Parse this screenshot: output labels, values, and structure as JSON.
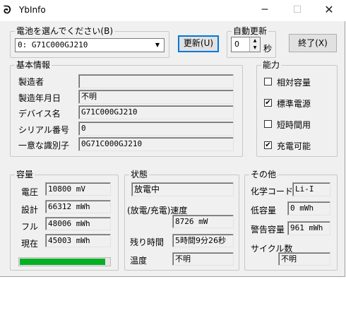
{
  "window": {
    "title": "YbInfo",
    "minimize_glyph": "─",
    "maximize_glyph": "☐",
    "close_glyph": "✕"
  },
  "battery_select": {
    "label": "電池を選んでください(B)",
    "selected": "0: G71C000GJ210",
    "arrow": "▼"
  },
  "refresh_button": {
    "label": "更新(U)"
  },
  "auto_refresh": {
    "label": "自動更新",
    "value": "0",
    "unit": "秒",
    "up": "▲",
    "down": "▼"
  },
  "exit_button": {
    "label": "終了(X)"
  },
  "basic_info": {
    "title": "基本情報",
    "rows": [
      {
        "label": "製造者",
        "value": ""
      },
      {
        "label": "製造年月日",
        "value": "不明"
      },
      {
        "label": "デバイス名",
        "value": "G71C000GJ210"
      },
      {
        "label": "シリアル番号",
        "value": "0"
      },
      {
        "label": "一意な識別子",
        "value": "0G71C000GJ210"
      }
    ]
  },
  "capability": {
    "title": "能力",
    "items": [
      {
        "label": "相対容量",
        "checked": false,
        "mark": ""
      },
      {
        "label": "標準電源",
        "checked": true,
        "mark": "✔"
      },
      {
        "label": "短時間用",
        "checked": false,
        "mark": ""
      },
      {
        "label": "充電可能",
        "checked": true,
        "mark": "✔"
      }
    ]
  },
  "capacity": {
    "title": "容量",
    "rows": [
      {
        "label": "電圧",
        "value": "10800 mV"
      },
      {
        "label": "設計",
        "value": "66312 mWh"
      },
      {
        "label": "フル",
        "value": "48006 mWh"
      },
      {
        "label": "現在",
        "value": "45003 mWh"
      }
    ],
    "charge_fraction": 0.94,
    "bar_color": "#06b025"
  },
  "status": {
    "title": "状態",
    "state": "放電中",
    "rate_label": "(放電/充電)速度",
    "rate_value": "8726 mW",
    "remaining_label": "残り時間",
    "remaining_value": "5時間9分26秒",
    "temperature_label": "温度",
    "temperature_value": "不明"
  },
  "other": {
    "title": "その他",
    "chemistry_label": "化学コード",
    "chemistry_value": "Li-I",
    "low_label": "低容量",
    "low_value": "0 mWh",
    "warning_label": "警告容量",
    "warning_value": "961 mWh",
    "cycle_label": "サイクル数",
    "cycle_value": "不明"
  }
}
